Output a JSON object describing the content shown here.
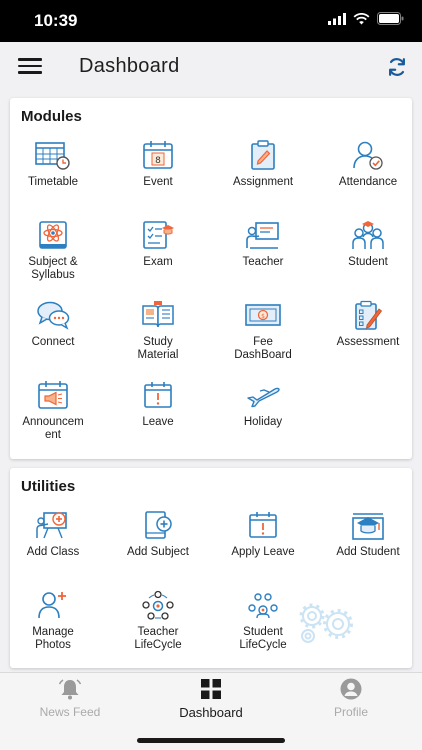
{
  "status_bar": {
    "time": "10:39"
  },
  "header": {
    "title": "Dashboard"
  },
  "modules": {
    "title": "Modules",
    "items": [
      {
        "label": "Timetable",
        "icon": "timetable-icon"
      },
      {
        "label": "Event",
        "icon": "calendar-icon"
      },
      {
        "label": "Assignment",
        "icon": "clipboard-pen-icon"
      },
      {
        "label": "Attendance",
        "icon": "user-check-icon"
      },
      {
        "label": "Subject &\nSyllabus",
        "icon": "atom-book-icon"
      },
      {
        "label": "Exam",
        "icon": "exam-sheet-icon"
      },
      {
        "label": "Teacher",
        "icon": "teacher-board-icon"
      },
      {
        "label": "Student",
        "icon": "students-group-icon"
      },
      {
        "label": "Connect",
        "icon": "chat-bubbles-icon"
      },
      {
        "label": "Study\nMaterial",
        "icon": "open-book-icon"
      },
      {
        "label": "Fee\nDashBoard",
        "icon": "banknote-icon"
      },
      {
        "label": "Assessment",
        "icon": "checklist-pencil-icon"
      },
      {
        "label": "Announcem\nent",
        "icon": "megaphone-calendar-icon"
      },
      {
        "label": "Leave",
        "icon": "calendar-alert-icon"
      },
      {
        "label": "Holiday",
        "icon": "airplane-icon"
      }
    ]
  },
  "utilities": {
    "title": "Utilities",
    "items": [
      {
        "label": "Add Class",
        "icon": "add-class-icon"
      },
      {
        "label": "Add Subject",
        "icon": "add-subject-icon"
      },
      {
        "label": "Apply Leave",
        "icon": "calendar-alert-icon"
      },
      {
        "label": "Add Student",
        "icon": "graduation-cap-icon"
      },
      {
        "label": "Manage\nPhotos",
        "icon": "add-user-icon"
      },
      {
        "label": "Teacher\nLifeCycle",
        "icon": "teacher-lifecycle-icon"
      },
      {
        "label": "Student\nLifeCycle",
        "icon": "student-lifecycle-icon"
      }
    ]
  },
  "bottom_nav": {
    "items": [
      {
        "label": "News Feed",
        "icon": "bell-icon",
        "active": false
      },
      {
        "label": "Dashboard",
        "icon": "dashboard-grid-icon",
        "active": true
      },
      {
        "label": "Profile",
        "icon": "profile-icon",
        "active": false
      }
    ]
  },
  "colors": {
    "accent_blue": "#2c7fc0",
    "accent_orange": "#f0663a",
    "card_bg": "#ffffff",
    "page_bg": "#f1f1f3"
  }
}
